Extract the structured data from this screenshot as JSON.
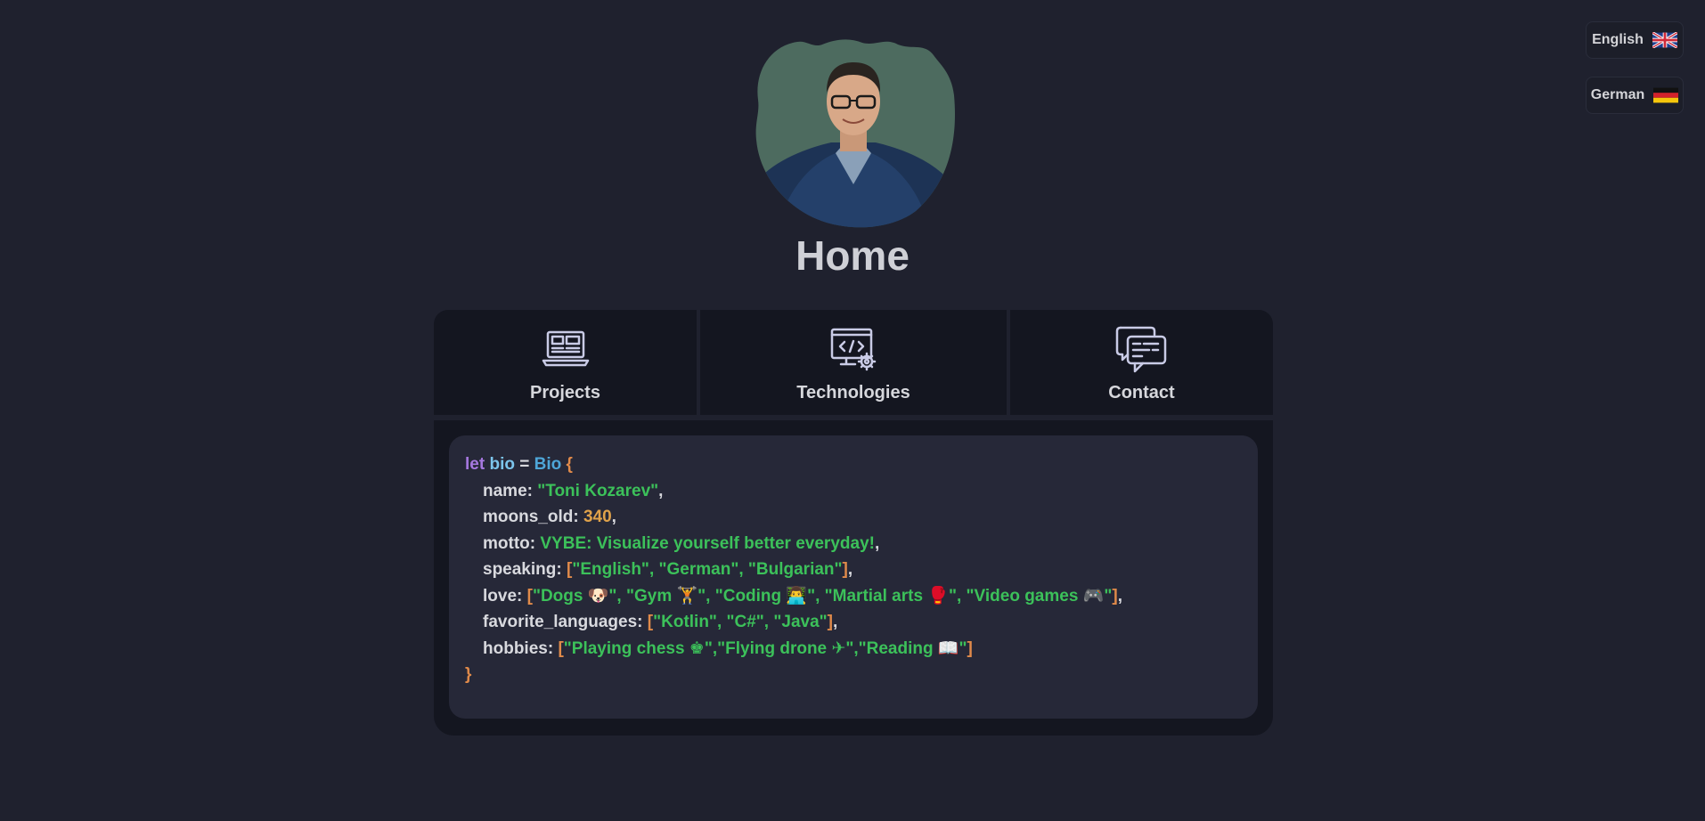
{
  "language_switcher": {
    "english_label": "English",
    "german_label": "German"
  },
  "profile": {
    "title": "Home"
  },
  "nav": {
    "projects": "Projects",
    "technologies": "Technologies",
    "contact": "Contact"
  },
  "bio": {
    "kw_let": "let",
    "var_name": "bio",
    "eq": " = ",
    "type_name": "Bio",
    "open_brace": " {",
    "close_brace": "}",
    "name_key": "name: ",
    "name_value": "\"Toni Kozarev\"",
    "moons_key": "moons_old: ",
    "moons_value": "340",
    "motto_key": "motto: ",
    "motto_value": "VYBE: Visualize yourself better everyday!",
    "speaking_key": "speaking: ",
    "speaking_value": "\"English\", \"German\", \"Bulgarian\"",
    "love_key": "love: ",
    "love_value": "\"Dogs 🐶\", \"Gym 🏋\", \"Coding 👨‍💻\", \"Martial arts 🥊\", \"Video games 🎮\"",
    "fav_key": "favorite_languages: ",
    "fav_value": "\"Kotlin\", \"C#\", \"Java\"",
    "hobbies_key": "hobbies: ",
    "hobbies_value": "\"Playing chess ♚\",\"Flying drone ✈\",\"Reading 📖\""
  },
  "colors": {
    "background": "#1f212e",
    "card": "#141620",
    "code_bg": "#262838",
    "keyword": "#a678e0",
    "string": "#3cc15a",
    "number": "#e0a24a",
    "bracket": "#e08a4a"
  },
  "icons": {
    "english_flag": "uk-flag-icon",
    "german_flag": "germany-flag-icon",
    "projects": "laptop-icon",
    "technologies": "code-monitor-gear-icon",
    "contact": "chat-bubbles-icon"
  }
}
